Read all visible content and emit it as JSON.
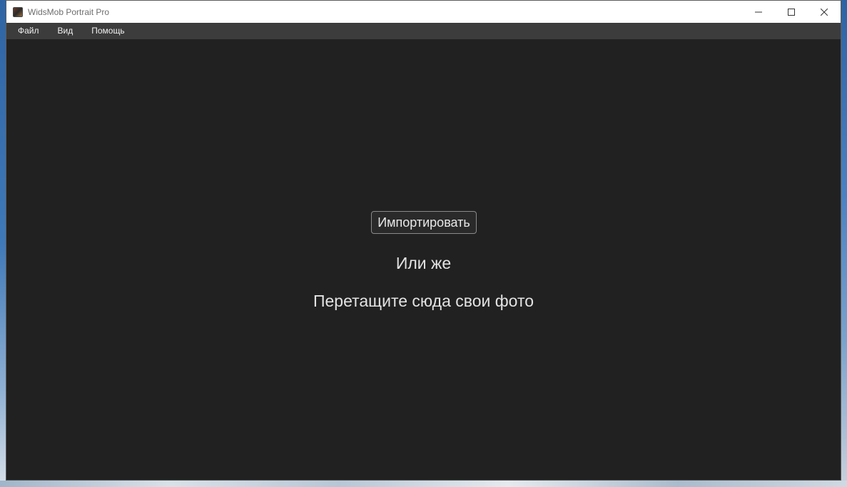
{
  "window": {
    "title": "WidsMob Portrait Pro",
    "controls": {
      "minimize_icon": "minimize-icon",
      "maximize_icon": "maximize-icon",
      "close_icon": "close-icon"
    }
  },
  "menubar": {
    "items": [
      {
        "label": "Файл"
      },
      {
        "label": "Вид"
      },
      {
        "label": "Помощь"
      }
    ]
  },
  "main": {
    "import_button_label": "Импортировать",
    "or_text": "Или же",
    "drop_text": "Перетащите сюда свои фото"
  },
  "colors": {
    "background": "#212121",
    "menubar": "#3c3c3c",
    "titlebar": "#ffffff",
    "text": "#e3e3e3"
  }
}
